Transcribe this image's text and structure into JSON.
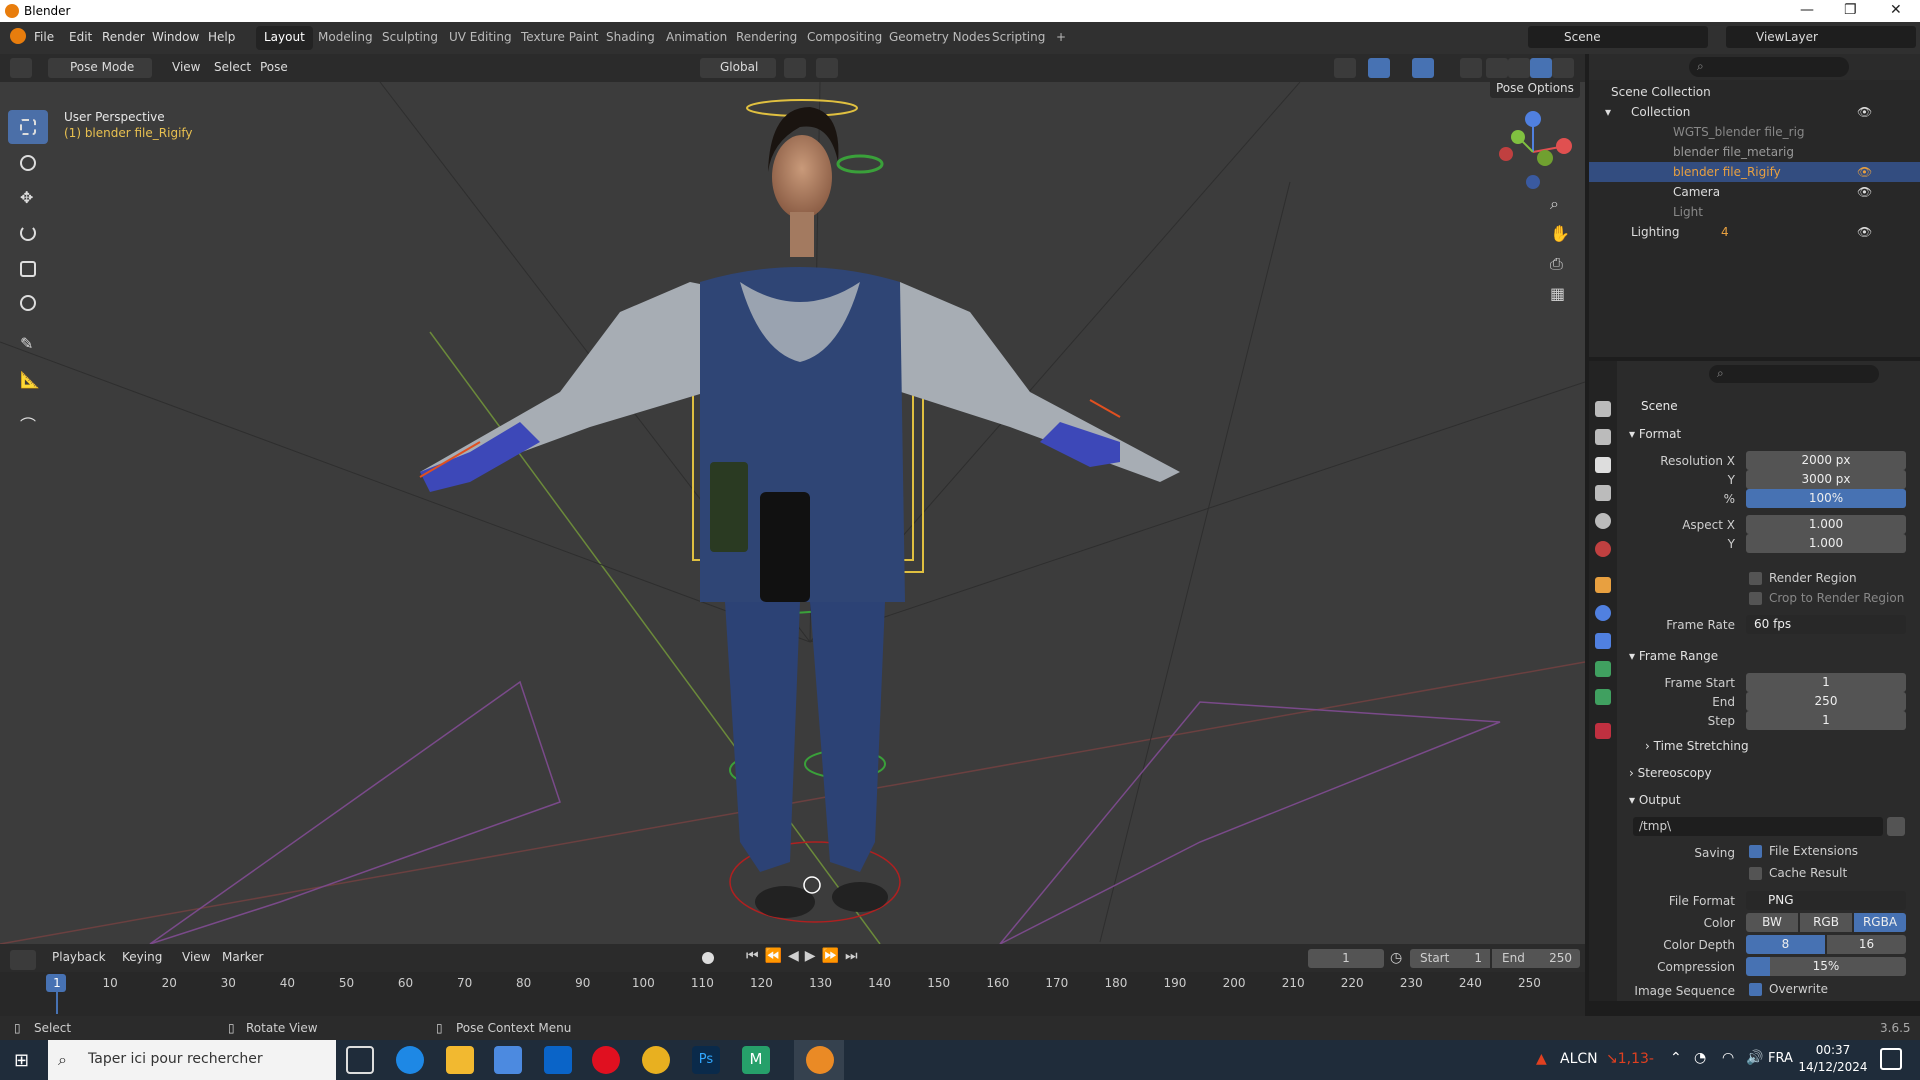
{
  "window": {
    "title": "Blender"
  },
  "menubar": {
    "items": [
      "File",
      "Edit",
      "Render",
      "Window",
      "Help"
    ],
    "workspaces": [
      "Layout",
      "Modeling",
      "Sculpting",
      "UV Editing",
      "Texture Paint",
      "Shading",
      "Animation",
      "Rendering",
      "Compositing",
      "Geometry Nodes",
      "Scripting"
    ],
    "add": "+",
    "scene": "Scene",
    "viewlayer": "ViewLayer"
  },
  "viewport_header": {
    "mode": "Pose Mode",
    "menus": [
      "View",
      "Select",
      "Pose"
    ],
    "transform": "Global",
    "pose_options": "Pose Options"
  },
  "viewport": {
    "perspective": "User Perspective",
    "object": "(1) blender file_Rigify"
  },
  "outliner": {
    "items": [
      {
        "label": "Scene Collection",
        "level": 0
      },
      {
        "label": "Collection",
        "level": 1
      },
      {
        "label": "WGTS_blender file_rig",
        "level": 2
      },
      {
        "label": "blender file_metarig",
        "level": 2
      },
      {
        "label": "blender file_Rigify",
        "level": 2,
        "selected": true
      },
      {
        "label": "Camera",
        "level": 2
      },
      {
        "label": "Light",
        "level": 2
      },
      {
        "label": "Lighting",
        "level": 1,
        "count": "4"
      }
    ]
  },
  "properties": {
    "context": "Scene",
    "format": {
      "title": "Format",
      "res_x_label": "Resolution X",
      "res_x": "2000 px",
      "res_y_label": "Y",
      "res_y": "3000 px",
      "pct_label": "%",
      "pct": "100%",
      "aspect_x_label": "Aspect X",
      "aspect_x": "1.000",
      "aspect_y_label": "Y",
      "aspect_y": "1.000",
      "render_region": "Render Region",
      "crop": "Crop to Render Region",
      "frame_rate_label": "Frame Rate",
      "frame_rate": "60 fps"
    },
    "frame_range": {
      "title": "Frame Range",
      "start_label": "Frame Start",
      "start": "1",
      "end_label": "End",
      "end": "250",
      "step_label": "Step",
      "step": "1",
      "time_stretching": "Time Stretching"
    },
    "stereoscopy": "Stereoscopy",
    "output": {
      "title": "Output",
      "path": "/tmp\\",
      "saving_label": "Saving",
      "file_ext": "File Extensions",
      "cache": "Cache Result",
      "file_format_label": "File Format",
      "file_format": "PNG",
      "color_label": "Color",
      "color_opts": [
        "BW",
        "RGB",
        "RGBA"
      ],
      "depth_label": "Color Depth",
      "depth_opts": [
        "8",
        "16"
      ],
      "compression_label": "Compression",
      "compression": "15%",
      "imgseq_label": "Image Sequence",
      "overwrite": "Overwrite"
    }
  },
  "timeline": {
    "menus": [
      "Playback",
      "Keying",
      "View",
      "Marker"
    ],
    "current": "1",
    "start_label": "Start",
    "start": "1",
    "end_label": "End",
    "end": "250",
    "ticks": [
      "1",
      "10",
      "20",
      "30",
      "40",
      "50",
      "60",
      "70",
      "80",
      "90",
      "100",
      "110",
      "120",
      "130",
      "140",
      "150",
      "160",
      "170",
      "180",
      "190",
      "200",
      "210",
      "220",
      "230",
      "240",
      "250"
    ]
  },
  "status": {
    "select": "Select",
    "rotate": "Rotate View",
    "context": "Pose Context Menu",
    "version": "3.6.5"
  },
  "taskbar": {
    "search": "Taper ici pour rechercher",
    "stock": "ALCN",
    "stock_change": "↘1,13-",
    "lang": "FRA",
    "time": "00:37",
    "date": "14/12/2024"
  },
  "colors": {
    "accent": "#4772b3",
    "selected_row": "#334d80",
    "viewport_bg": "#3c3c3c"
  }
}
